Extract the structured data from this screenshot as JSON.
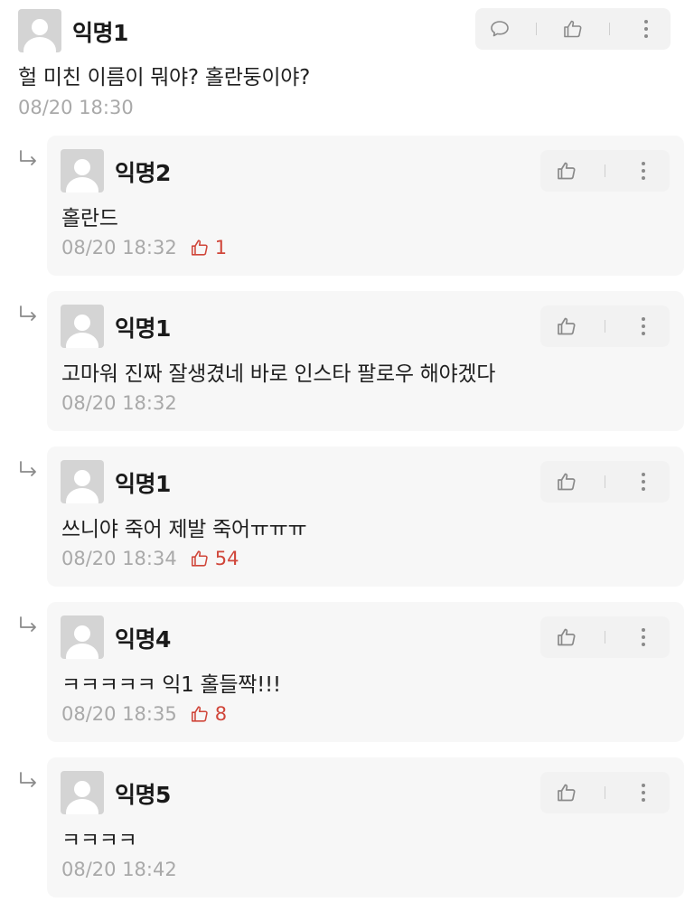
{
  "comment": {
    "author": "익명1",
    "text": "헐 미친 이름이 뭐야? 홀란둥이야?",
    "time": "08/20 18:30"
  },
  "replies": [
    {
      "author": "익명2",
      "text": "홀란드",
      "time": "08/20 18:32",
      "votes": "1"
    },
    {
      "author": "익명1",
      "text": "고마워 진짜 잘생겼네 바로 인스타 팔로우 해야겠다",
      "time": "08/20 18:32",
      "votes": ""
    },
    {
      "author": "익명1",
      "text": "쓰니야 죽어 제발 죽어ㅠㅠㅠ",
      "time": "08/20 18:34",
      "votes": "54"
    },
    {
      "author": "익명4",
      "text": "ㅋㅋㅋㅋㅋ 익1 홀들짝!!!",
      "time": "08/20 18:35",
      "votes": "8"
    },
    {
      "author": "익명5",
      "text": "ㅋㅋㅋㅋ",
      "time": "08/20 18:42",
      "votes": ""
    }
  ],
  "icons": {
    "comment": "speech-bubble-icon",
    "like": "thumbs-up-icon",
    "more": "vertical-dots-icon",
    "reply": "reply-arrow-icon",
    "avatar": "default-avatar"
  },
  "colors": {
    "vote_accent": "#d0463a",
    "meta_gray": "#a9a9a9",
    "card_bg": "#f7f7f7"
  }
}
